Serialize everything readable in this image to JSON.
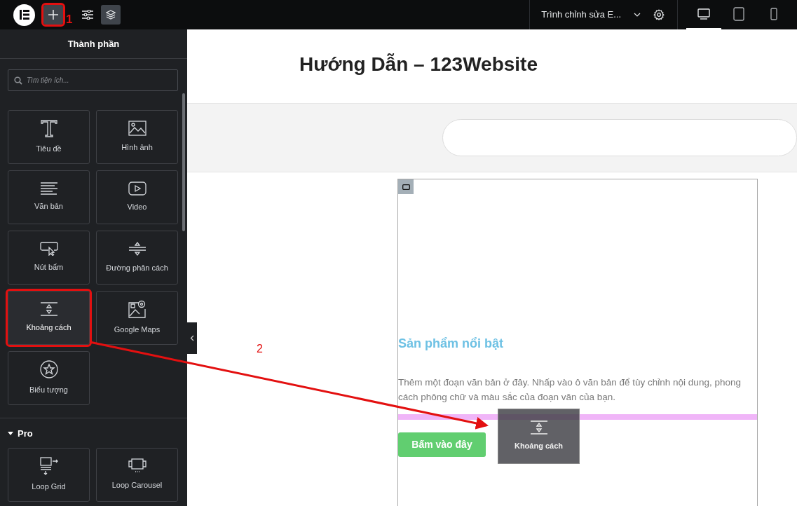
{
  "topbar": {
    "add_button": {
      "highlighted": true
    },
    "annotation": "1",
    "editor_menu": "Trình chỉnh sửa E...",
    "devices": [
      {
        "kind": "desktop",
        "selected": true
      },
      {
        "kind": "tablet",
        "selected": false
      },
      {
        "kind": "mobile",
        "selected": false
      }
    ]
  },
  "panel": {
    "title": "Thành phần",
    "search": {
      "placeholder": "Tìm tiện ích..."
    },
    "widgets": [
      {
        "kind": "heading",
        "label": "Tiêu đề",
        "highlighted": false
      },
      {
        "kind": "image",
        "label": "Hình ảnh",
        "highlighted": false
      },
      {
        "kind": "text",
        "label": "Văn bản",
        "highlighted": false
      },
      {
        "kind": "video",
        "label": "Video",
        "highlighted": false
      },
      {
        "kind": "button",
        "label": "Nút bấm",
        "highlighted": false
      },
      {
        "kind": "divider",
        "label": "Đường phân cách",
        "highlighted": false
      },
      {
        "kind": "spacer",
        "label": "Khoảng cách",
        "highlighted": true
      },
      {
        "kind": "map",
        "label": "Google Maps",
        "highlighted": false
      },
      {
        "kind": "icon",
        "label": "Biểu tượng",
        "highlighted": false
      }
    ],
    "sections": [
      {
        "title": "Pro",
        "expanded": true,
        "widgets": [
          {
            "kind": "loopgrid",
            "label": "Loop Grid",
            "highlighted": false
          },
          {
            "kind": "carousel",
            "label": "Loop Carousel",
            "highlighted": false
          }
        ]
      }
    ]
  },
  "canvas": {
    "site_title": "Hướng Dẫn – 123Website",
    "heading": "Sản phẩm nổi bật",
    "paragraph": "Thêm một đoạn văn bản ở đây. Nhấp vào ô văn bản để tùy chỉnh nội dung, phong cách phông chữ và màu sắc của đoạn văn của bạn.",
    "button": "Bấm vào đây",
    "drag_ghost": {
      "kind": "spacer",
      "label": "Khoảng cách"
    }
  },
  "annotation": {
    "label": "2"
  }
}
